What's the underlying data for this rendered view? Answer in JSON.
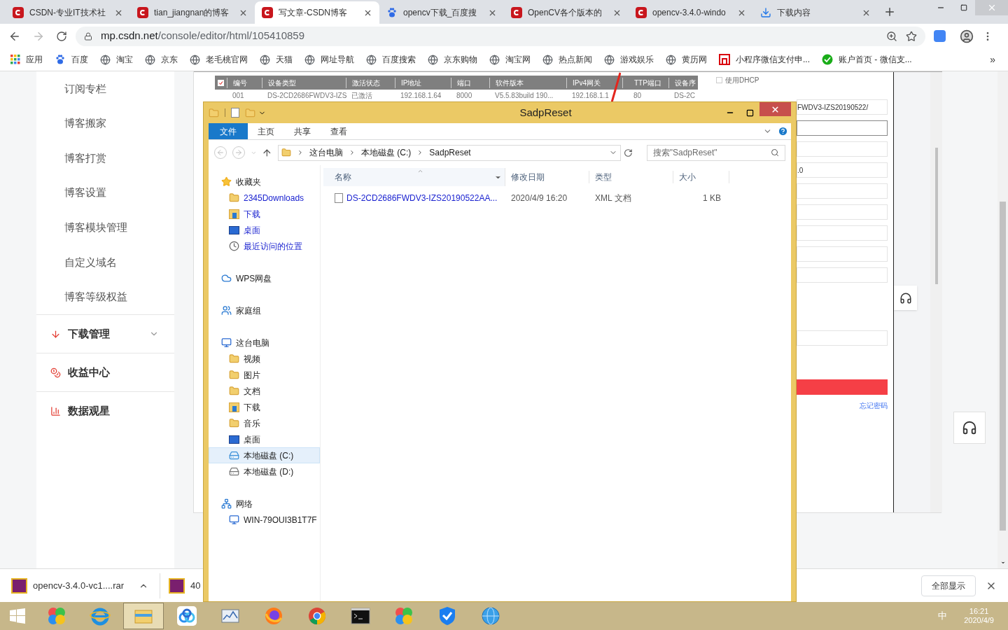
{
  "browser": {
    "tabs": [
      {
        "label": "CSDN-专业IT技术社",
        "kind": "csdn",
        "selected": false
      },
      {
        "label": "tian_jiangnan的博客",
        "kind": "csdn",
        "selected": false
      },
      {
        "label": "写文章-CSDN博客",
        "kind": "csdn",
        "selected": true
      },
      {
        "label": "opencv下载_百度搜",
        "kind": "baidu",
        "selected": false
      },
      {
        "label": "OpenCV各个版本的",
        "kind": "csdn",
        "selected": false
      },
      {
        "label": "opencv-3.4.0-windo",
        "kind": "csdn",
        "selected": false
      },
      {
        "label": "下载内容",
        "kind": "download",
        "selected": false
      }
    ],
    "url_host": "mp.csdn.net",
    "url_path": "/console/editor/html/105410859",
    "bookmarks": [
      {
        "label": "应用",
        "kind": "apps"
      },
      {
        "label": "百度",
        "kind": "baidu"
      },
      {
        "label": "淘宝",
        "kind": "globe"
      },
      {
        "label": "京东",
        "kind": "globe"
      },
      {
        "label": "老毛桃官网",
        "kind": "globe"
      },
      {
        "label": "天猫",
        "kind": "globe"
      },
      {
        "label": "网址导航",
        "kind": "globe"
      },
      {
        "label": "百度搜索",
        "kind": "globe"
      },
      {
        "label": "京东购物",
        "kind": "globe"
      },
      {
        "label": "淘宝网",
        "kind": "globe"
      },
      {
        "label": "热点新闻",
        "kind": "globe"
      },
      {
        "label": "游戏娱乐",
        "kind": "globe"
      },
      {
        "label": "黄历网",
        "kind": "globe"
      },
      {
        "label": "小程序微信支付申...",
        "kind": "letter"
      },
      {
        "label": "账户首页 - 微信支...",
        "kind": "wechat"
      }
    ],
    "more": "»"
  },
  "sidebar": {
    "items": [
      {
        "label": "订阅专栏",
        "kind": "plain"
      },
      {
        "label": "博客搬家",
        "kind": "plain"
      },
      {
        "label": "博客打赏",
        "kind": "plain"
      },
      {
        "label": "博客设置",
        "kind": "plain"
      },
      {
        "label": "博客模块管理",
        "kind": "plain"
      },
      {
        "label": "自定义域名",
        "kind": "plain"
      },
      {
        "label": "博客等级权益",
        "kind": "plain"
      },
      {
        "label": "下载管理",
        "kind": "download",
        "expanded": false
      },
      {
        "label": "收益中心",
        "kind": "income"
      },
      {
        "label": "数据观星",
        "kind": "data"
      }
    ]
  },
  "sadp": {
    "columns": [
      "编号",
      "设备类型",
      "激活状态",
      "IP地址",
      "端口",
      "软件版本",
      "IPv4网关",
      "TTP端口",
      "设备序"
    ],
    "row": {
      "checked": true,
      "cells": [
        "001",
        "DS-2CD2686FWDV3-IZS",
        "已激活",
        "192.168.1.64",
        "8000",
        "V5.5.83build 190...",
        "192.168.1.1",
        "80",
        "DS-2C"
      ]
    },
    "dhcp": {
      "label": "使用DHCP",
      "checked": false
    },
    "fields": [
      {
        "value": "FWDV3-IZS20190522/",
        "focused": false
      },
      {
        "focused": true
      },
      {
        "focused": false
      },
      {
        "value": ".0",
        "focused": false
      },
      {
        "focused": false
      },
      {
        "focused": false
      },
      {
        "focused": false
      },
      {
        "focused": false
      },
      {
        "focused": false
      }
    ],
    "link": "忘记密码"
  },
  "explorer": {
    "title": "SadpReset",
    "ribbon_tabs": [
      {
        "label": "文件",
        "selected": true
      },
      {
        "label": "主页",
        "selected": false
      },
      {
        "label": "共享",
        "selected": false
      },
      {
        "label": "查看",
        "selected": false
      }
    ],
    "path": [
      "这台电脑",
      "本地磁盘 (C:)",
      "SadpReset"
    ],
    "search_placeholder": "搜索\"SadpReset\"",
    "columns": [
      "名称",
      "修改日期",
      "类型",
      "大小"
    ],
    "files": [
      {
        "name": "DS-2CD2686FWDV3-IZS20190522AA...",
        "modified": "2020/4/9 16:20",
        "type": "XML 文档",
        "size": "1 KB"
      }
    ],
    "nav": [
      {
        "label": "收藏夹",
        "kind": "star",
        "children": [
          {
            "label": "2345Downloads",
            "kind": "folder",
            "selected": false
          },
          {
            "label": "下载",
            "kind": "download-folder",
            "selected": false
          },
          {
            "label": "桌面",
            "kind": "desktop",
            "selected": false
          },
          {
            "label": "最近访问的位置",
            "kind": "recent",
            "selected": false
          }
        ]
      },
      {
        "label": "WPS网盘",
        "kind": "cloud"
      },
      {
        "label": "家庭组",
        "kind": "homegroup"
      },
      {
        "label": "这台电脑",
        "kind": "computer",
        "children": [
          {
            "label": "视频",
            "kind": "folder",
            "selected": false
          },
          {
            "label": "图片",
            "kind": "folder",
            "selected": false
          },
          {
            "label": "文档",
            "kind": "folder",
            "selected": false
          },
          {
            "label": "下载",
            "kind": "download-folder",
            "selected": false
          },
          {
            "label": "音乐",
            "kind": "folder",
            "selected": false
          },
          {
            "label": "桌面",
            "kind": "desktop",
            "selected": false
          },
          {
            "label": "本地磁盘 (C:)",
            "kind": "drive-c",
            "selected": true
          },
          {
            "label": "本地磁盘 (D:)",
            "kind": "drive",
            "selected": false
          }
        ]
      },
      {
        "label": "网络",
        "kind": "network",
        "children": [
          {
            "label": "WIN-79OUI3B1T7F",
            "kind": "computer",
            "selected": false
          }
        ]
      }
    ]
  },
  "downloads": {
    "items": [
      {
        "name": "opencv-3.4.0-vc1....rar",
        "caret": true
      },
      {
        "name": "40",
        "caret": false
      }
    ],
    "show_all": "全部显示"
  },
  "taskbar": {
    "apps": [
      {
        "kind": "pinwheel",
        "active": false
      },
      {
        "kind": "ie",
        "active": false
      },
      {
        "kind": "explorer",
        "active": true
      },
      {
        "kind": "netdisk",
        "active": false
      },
      {
        "kind": "monitor",
        "active": false
      },
      {
        "kind": "firefox",
        "active": false
      },
      {
        "kind": "chrome",
        "active": false
      },
      {
        "kind": "cmd",
        "active": false
      },
      {
        "kind": "pinwheel",
        "active": false
      },
      {
        "kind": "shield",
        "active": false
      },
      {
        "kind": "globe",
        "active": false
      }
    ],
    "ime": "中",
    "time": "16:21",
    "date": "2020/4/9"
  }
}
